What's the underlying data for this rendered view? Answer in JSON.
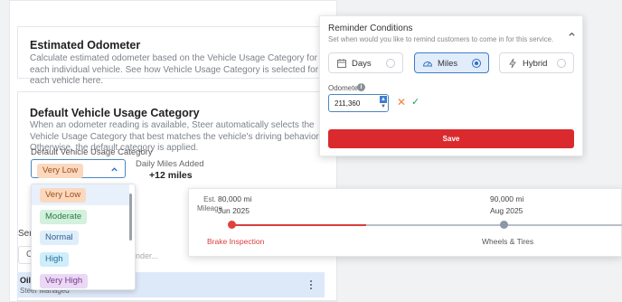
{
  "estimated_odometer": {
    "title": "Estimated Odometer",
    "description": "Calculate estimated odometer based on the Vehicle Usage Category for each individual vehicle. See how Vehicle Usage Category is selected for each vehicle here."
  },
  "usage_category": {
    "title": "Default Vehicle Usage Category",
    "description": "When an odometer reading is available, Steer automatically selects the Vehicle Usage Category that best matches the vehicle's driving behavior. Otherwise, the default category is applied.",
    "field_label": "Default Vehicle Usage Category",
    "selected": "Very Low",
    "options": [
      "Very Low",
      "Moderate",
      "Normal",
      "High",
      "Very High"
    ],
    "daily_miles_label": "Daily Miles Added",
    "daily_miles_value": "+12 miles"
  },
  "services": {
    "label_fragment": "Ser",
    "search_fragment": "C",
    "placeholder_fragment": "nder...",
    "row_title": "Oil C",
    "row_subtitle": "Steer Managed"
  },
  "reminder": {
    "title": "Reminder Conditions",
    "subtitle": "Set when would you like to remind customers to come in for this service.",
    "options": [
      {
        "label": "Days",
        "icon": "calendar-icon",
        "selected": false
      },
      {
        "label": "Miles",
        "icon": "gauge-icon",
        "selected": true
      },
      {
        "label": "Hybrid",
        "icon": "lightning-icon",
        "selected": false
      }
    ],
    "odometer_label": "Odometer",
    "odometer_value": "211,360",
    "save_label": "Save"
  },
  "timeline": {
    "est_label_1": "Est.",
    "est_label_2": "Mileage",
    "events": [
      {
        "mileage": "80,000 mi",
        "date": "Jun 2025",
        "name": "Brake Inspection"
      },
      {
        "mileage": "90,000 mi",
        "date": "Aug 2025",
        "name": "Wheels & Tires"
      }
    ]
  },
  "colors": {
    "accent_blue": "#3e7dcc",
    "save_red": "#da2a2e",
    "timeline_red": "#d83d3d"
  }
}
